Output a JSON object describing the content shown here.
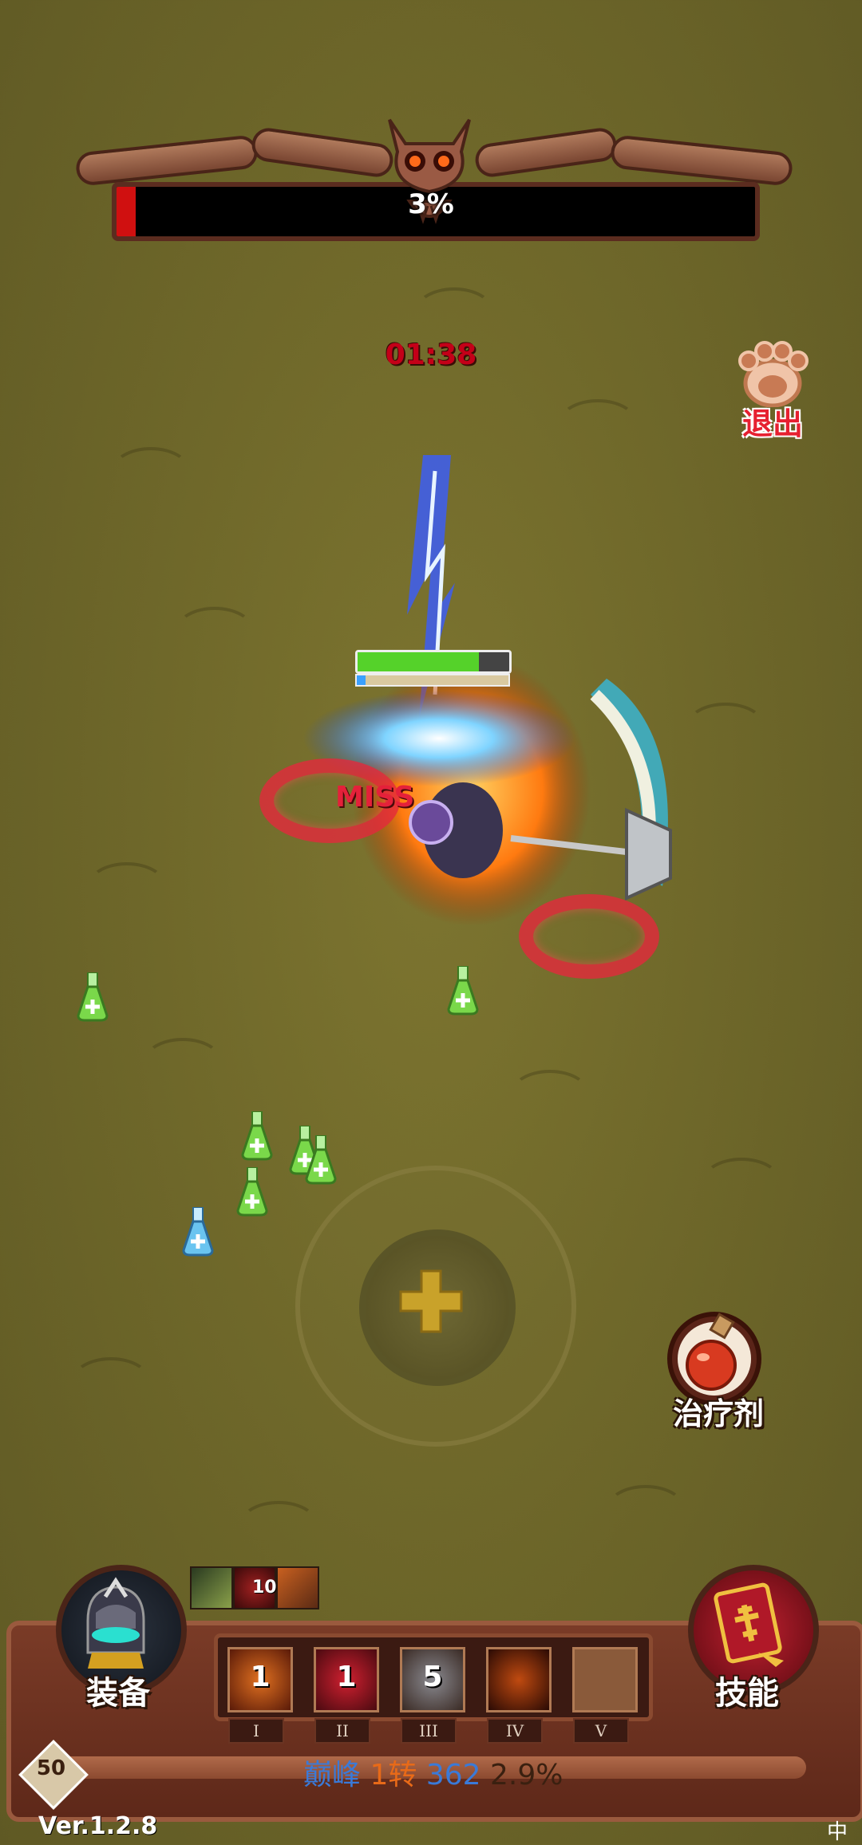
{
  "boss": {
    "hp_percent_label": "3%",
    "hp_fraction": 0.03
  },
  "timer": "01:38",
  "exit": {
    "label": "退出",
    "icon": "paw-icon"
  },
  "combat": {
    "miss_text": "MISS",
    "player_hp_fraction": 0.8,
    "player_mp_fraction": 0.06
  },
  "heal": {
    "label": "治疗剂",
    "icon": "potion-icon"
  },
  "equipment": {
    "label": "装备",
    "icon": "hero-portrait-icon"
  },
  "skills": {
    "label": "技能",
    "icon": "spellbook-icon"
  },
  "buffs": [
    {
      "icon": "slash-buff-icon",
      "count": ""
    },
    {
      "icon": "flame-buff-icon",
      "count": "10"
    },
    {
      "icon": "blade-buff-icon",
      "count": ""
    }
  ],
  "slots": [
    {
      "roman": "I",
      "count": "1",
      "icon": "fire-blade-skill-icon"
    },
    {
      "roman": "II",
      "count": "1",
      "icon": "crimson-slash-skill-icon"
    },
    {
      "roman": "III",
      "count": "5",
      "icon": "knight-helm-skill-icon"
    },
    {
      "roman": "IV",
      "count": "",
      "icon": "demon-skill-icon"
    },
    {
      "roman": "V",
      "count": "",
      "icon": "empty-slot-icon"
    }
  ],
  "level": "50",
  "xp": {
    "rank": "巅峰",
    "rebirth": "1转",
    "level": "362",
    "percent": "2.9%",
    "fraction": 0.029
  },
  "version": "Ver.1.2.8",
  "ime": "中",
  "colors": {
    "boss_red": "#d01010",
    "timer_red": "#c40018",
    "panel_brown": "#7a3b27",
    "hp_green": "#55d22a"
  }
}
